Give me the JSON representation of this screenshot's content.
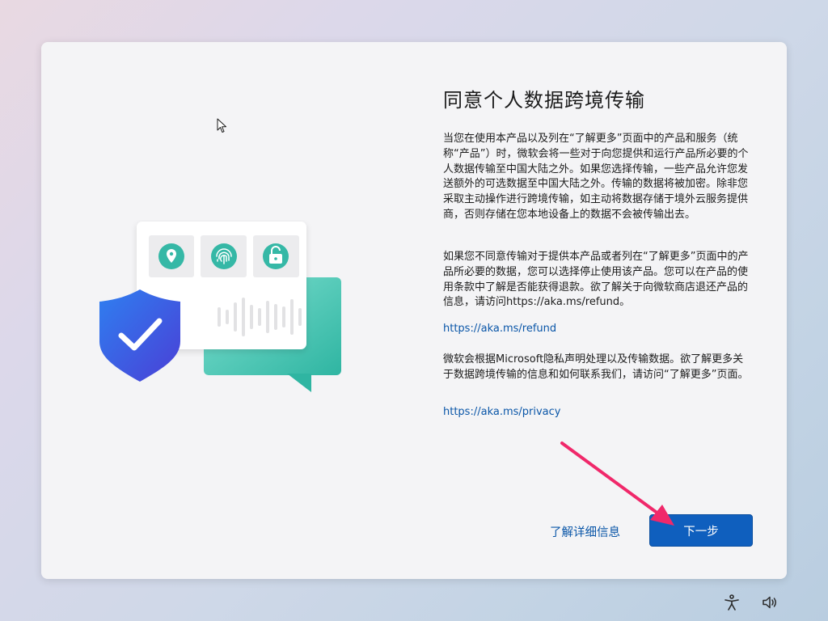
{
  "dialog": {
    "title": "同意个人数据跨境传输",
    "paragraph1": "当您在使用本产品以及列在“了解更多”页面中的产品和服务（统称“产品”）时，微软会将一些对于向您提供和运行产品所必要的个人数据传输至中国大陆之外。如果您选择传输，一些产品允许您发送额外的可选数据至中国大陆之外。传输的数据将被加密。除非您采取主动操作进行跨境传输，如主动将数据存储于境外云服务提供商，否则存储在您本地设备上的数据不会被传输出去。",
    "paragraph2": "如果您不同意传输对于提供本产品或者列在“了解更多”页面中的产品所必要的数据，您可以选择停止使用该产品。您可以在产品的使用条款中了解是否能获得退款。欲了解关于向微软商店退还产品的信息，请访问https://aka.ms/refund。",
    "refund_link": "https://aka.ms/refund",
    "paragraph3": "微软会根据Microsoft隐私声明处理以及传输数据。欲了解更多关于数据跨境传输的信息和如何联系我们，请访问“了解更多”页面。",
    "privacy_link": "https://aka.ms/privacy",
    "learn_more": "了解详细信息",
    "next_button": "下一步"
  },
  "illustration_icons": [
    "location-pin-icon",
    "fingerprint-icon",
    "padlock-icon",
    "shield-check-icon",
    "chat-bubble-icon",
    "waveform-icon"
  ],
  "taskbar": {
    "icons": [
      "accessibility-icon",
      "volume-icon"
    ]
  },
  "colors": {
    "accent": "#0f5fbe",
    "link": "#0a56a8",
    "teal": "#3cc1ad",
    "shield": "#3a5fe0",
    "annotation_arrow": "#f0286a"
  }
}
